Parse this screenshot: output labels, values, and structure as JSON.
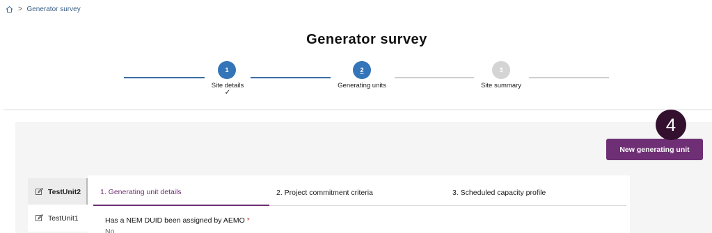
{
  "breadcrumb": {
    "home_icon": "home-icon",
    "separator": ">",
    "current": "Generator survey"
  },
  "page": {
    "title": "Generator survey"
  },
  "stepper": {
    "steps": [
      {
        "number": "1",
        "label": "Site details",
        "status": "done",
        "check": "✓"
      },
      {
        "number": "2",
        "label": "Generating units",
        "status": "current"
      },
      {
        "number": "3",
        "label": "Site summary",
        "status": "todo"
      }
    ]
  },
  "actions": {
    "new_unit_label": "New generating unit"
  },
  "badge": {
    "number": "4"
  },
  "units": [
    {
      "name": "TestUnit2",
      "active": true
    },
    {
      "name": "TestUnit1",
      "active": false
    }
  ],
  "tabs": [
    {
      "label": "1. Generating unit details",
      "active": true
    },
    {
      "label": "2. Project commitment criteria",
      "active": false
    },
    {
      "label": "3. Scheduled capacity profile",
      "active": false
    }
  ],
  "form": {
    "question": "Has a NEM DUID been assigned by AEMO",
    "required_marker": "*",
    "answer": "No"
  },
  "colors": {
    "primary": "#6e2f74",
    "step_blue": "#3474b8",
    "badge": "#33102e"
  }
}
